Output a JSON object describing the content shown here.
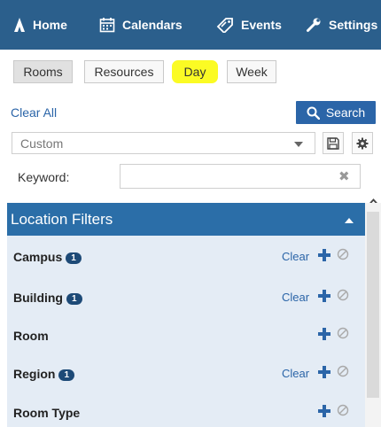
{
  "nav": {
    "items": [
      {
        "label": "Home",
        "icon": "home-icon"
      },
      {
        "label": "Calendars",
        "icon": "calendar-icon"
      },
      {
        "label": "Events",
        "icon": "tag-icon"
      },
      {
        "label": "Settings",
        "icon": "wrench-icon"
      }
    ]
  },
  "view_tabs": [
    {
      "label": "Rooms",
      "state": "active"
    },
    {
      "label": "Resources",
      "state": "normal"
    },
    {
      "label": "Day",
      "state": "highlighted"
    },
    {
      "label": "Week",
      "state": "normal"
    }
  ],
  "actions": {
    "clear_all": "Clear All",
    "search": "Search"
  },
  "saved_search": {
    "selected": "Custom"
  },
  "keyword": {
    "label": "Keyword:",
    "value": ""
  },
  "location_filters": {
    "title": "Location Filters",
    "clear_label": "Clear",
    "rows": [
      {
        "label": "Campus",
        "badge": "1",
        "show_clear": true
      },
      {
        "label": "Building",
        "badge": "1",
        "show_clear": true
      },
      {
        "label": "Room",
        "badge": "",
        "show_clear": false
      },
      {
        "label": "Region",
        "badge": "1",
        "show_clear": true
      },
      {
        "label": "Room Type",
        "badge": "",
        "show_clear": false
      }
    ]
  },
  "colors": {
    "nav_bg": "#2b5f8c",
    "panel_header": "#2b6ea8",
    "panel_bg": "#e4ecf5",
    "badge": "#1d4a77",
    "highlight": "#fbfb24",
    "link": "#2b65a8"
  }
}
